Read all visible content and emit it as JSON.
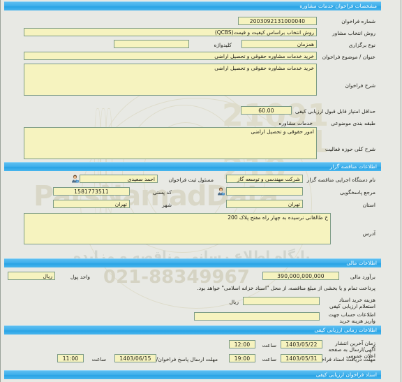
{
  "sections": {
    "tender_spec": "مشخصات فراخوان خدمات مشاوره",
    "employer_info": "اطلاعات مناقصه گزار",
    "financial_info": "اطلاعات مالی",
    "qualitative_time_info": "اطلاعات زمانی ارزیابی کیفی",
    "qualitative_docs": "اسناد فراخوان ارزیابی کیفی"
  },
  "tender": {
    "number_label": "شماره فراخوان",
    "number_value": "2003092131000040",
    "consultant_method_label": "روش انتخاب مشاور",
    "consultant_method_value": "روش انتخاب براساس کیفیت و قیمت(QCBS)",
    "holding_type_label": "نوع برگزاری",
    "holding_type_value": "همزمان",
    "keyword_label": "کلیدواژه",
    "keyword_value": "",
    "title_label": "عنوان / موضوع فراخوان",
    "title_value": "خرید خدمات مشاوره حقوقی و تحصیل اراضی",
    "description_label": "شرح فراخوان",
    "description_value": "خرید خدمات مشاوره حقوقی و تحصیل اراضی",
    "min_score_label": "حداقل امتیاز قابل قبول ارزیابی کیفی",
    "min_score_value": "60.00",
    "classification_label": "طبقه بندی موضوعی",
    "classification_value": "خدمات مشاوره",
    "activity_scope_label": "شرح کلی حوزه فعالیت",
    "activity_scope_value": "امور حقوقی و تحصیل اراضی"
  },
  "employer": {
    "org_label": "نام دستگاه اجرایی مناقصه گزار",
    "org_value": "شرکت مهندسی و توسعه گاز",
    "registrar_label": "مسئول ثبت فراخوان",
    "registrar_value": "احمد سعیدی",
    "contact_label": "مرجع پاسخگویی",
    "contact_value": "",
    "postal_code_label": "کد پستی",
    "postal_code_value": "1581773511",
    "province_label": "استان",
    "province_value": "تهران",
    "city_label": "شهر",
    "city_value": "تهران",
    "address_label": "آدرس",
    "address_value": "خ طالقانی نرسیده به چهار راه مفتح پلاک 200",
    "registrar_icon": "person-icon",
    "contact_icon": "person-icon"
  },
  "financial": {
    "estimate_label": "برآورد مالی",
    "estimate_value": "390,000,000,000",
    "currency_label": "واحد پول",
    "currency_value": "ریال",
    "payment_note": "پرداخت تمام و یا بخشی از مبلغ مناقصه، از محل \"اسناد خزانه اسلامی\" خواهد بود.",
    "doc_cost_label": "هزینه خرید اسناد استعلام ارزیابی کیفی",
    "doc_cost_value": "",
    "doc_cost_currency": "ریال",
    "account_label": "اطلاعات حساب جهت واریز هزینه خرید",
    "account_value": ""
  },
  "timing": {
    "publish_label": "زمان آخرین انتشار آگهی/ارسال به صفحه اعلان عمومی",
    "publish_date": "1403/05/22",
    "publish_hour_label": "ساعت",
    "publish_time": "12:00",
    "receive_label": "مهلت دریافت اسناد فراخوان/استعلام",
    "receive_date": "1403/05/31",
    "receive_hour_label": "ساعت",
    "receive_time": "19:00",
    "response_label": "مهلت ارسال پاسخ فراخوان/استعلام",
    "response_date": "1403/06/15",
    "response_hour_label": "ساعت",
    "response_time": "11:00"
  },
  "watermark": {
    "brand": "ParsNamadData",
    "digits_top": "21091",
    "digits_mid": "21091",
    "digits_bottom": "210",
    "fa_line1": "مرکز فراوری اطلاعات پارس نماد داده ها",
    "fa_line2": "پایگاه اطلاع رسانی مناقصه و مزایده",
    "phone": "021-88349967"
  },
  "colors": {
    "section_bar": "#3fb0ec",
    "field_bg": "#f6f3bf",
    "field_border": "#7d9c86",
    "page_bg": "#e8e9e4"
  }
}
